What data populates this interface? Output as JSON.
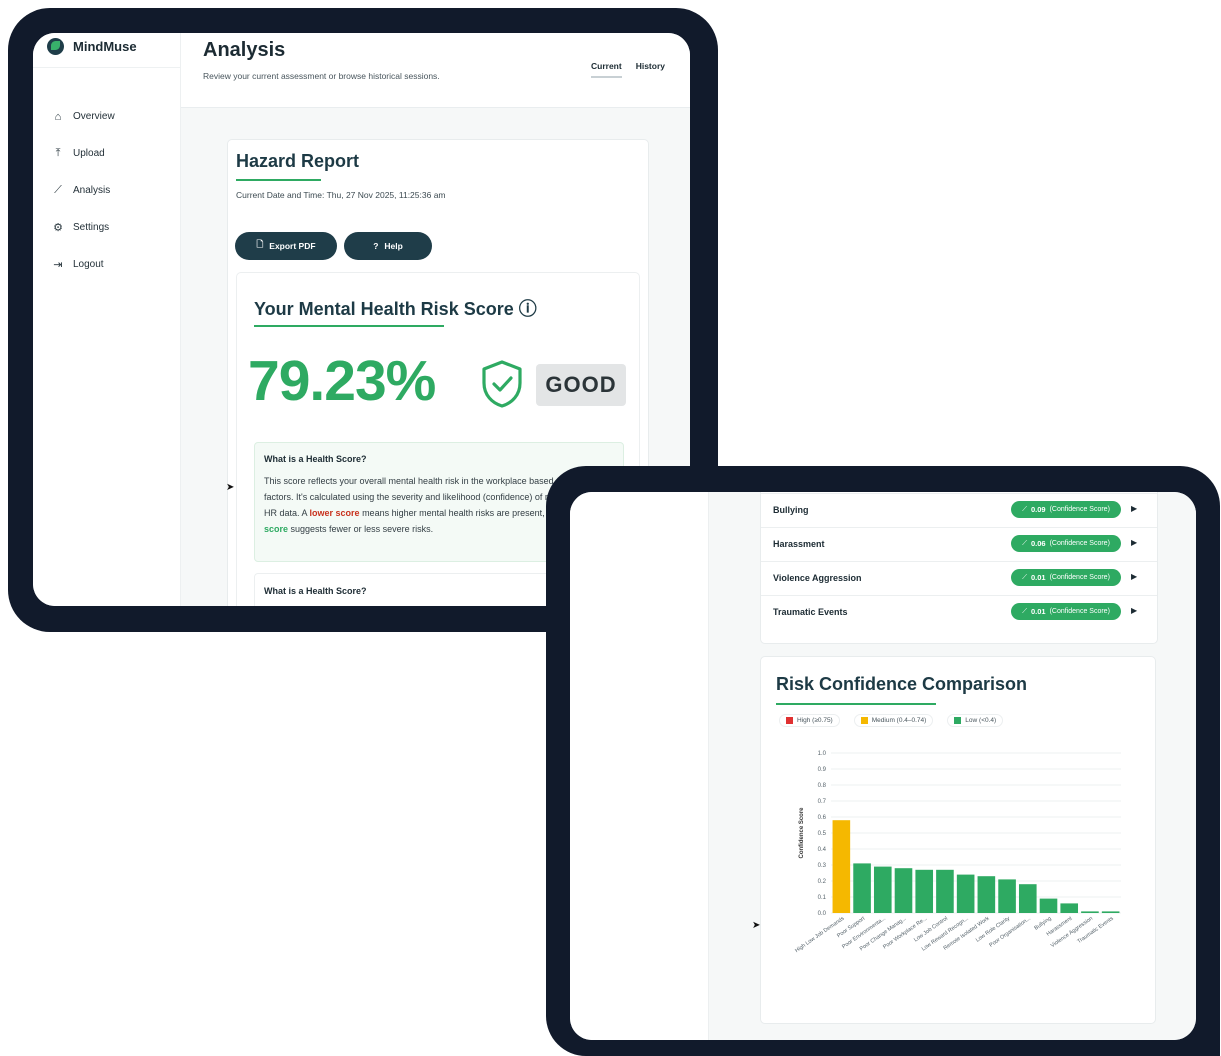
{
  "app": {
    "name": "MindMuse"
  },
  "sidebar": {
    "items": [
      {
        "label": "Overview",
        "icon": "home-icon"
      },
      {
        "label": "Upload",
        "icon": "upload-icon"
      },
      {
        "label": "Analysis",
        "icon": "chart-line-icon"
      },
      {
        "label": "Settings",
        "icon": "gear-icon"
      },
      {
        "label": "Logout",
        "icon": "logout-icon"
      }
    ]
  },
  "header": {
    "title": "Analysis",
    "subtitle": "Review your current assessment or browse historical sessions.",
    "tabs": [
      {
        "label": "Current"
      },
      {
        "label": "History"
      }
    ]
  },
  "report": {
    "title": "Hazard Report",
    "date_label": "Current Date and Time:",
    "date_value": "Thu, 27 Nov 2025, 11:25:36 am",
    "export_label": "Export PDF",
    "help_label": "Help"
  },
  "score": {
    "title": "Your Mental Health Risk Score",
    "info_symbol": "ⓘ",
    "value": "79.23%",
    "status": "GOOD",
    "info_heading": "What is a Health Score?",
    "info_text_1": "This score reflects your overall mental health risk in the workplace based on multiple factors. It's calculated using the severity and likelihood (confidence) of risks from your HR data. A ",
    "info_lower": "lower score",
    "info_text_2": " means higher mental health risks are present, while a ",
    "info_higher": "higher score",
    "info_text_3": " suggests fewer or less severe risks.",
    "info_heading_2": "What is a Health Score?"
  },
  "risks": {
    "confidence_suffix": "(Confidence Score)",
    "rows": [
      {
        "name": "Bullying",
        "score": "0.09"
      },
      {
        "name": "Harassment",
        "score": "0.06"
      },
      {
        "name": "Violence Aggression",
        "score": "0.01"
      },
      {
        "name": "Traumatic Events",
        "score": "0.01"
      }
    ]
  },
  "colors": {
    "accent": "#2eaa62",
    "dark": "#1f3d49",
    "high": "#e03131",
    "medium": "#f5b800",
    "low": "#2eaa62",
    "frame": "#111a2b"
  },
  "chart_data": {
    "type": "bar",
    "title": "Risk Confidence Comparison",
    "ylabel": "Confidence Score",
    "xlabel": "",
    "ylim": [
      0,
      1.0
    ],
    "yticks": [
      "1.0",
      "0.9",
      "0.8",
      "0.7",
      "0.6",
      "0.5",
      "0.4",
      "0.3",
      "0.2",
      "0.1",
      "0.0"
    ],
    "legend": [
      {
        "label": "High (≥0.75)",
        "color": "#e03131"
      },
      {
        "label": "Medium (0.4–0.74)",
        "color": "#f5b800"
      },
      {
        "label": "Low (<0.4)",
        "color": "#2eaa62"
      }
    ],
    "categories": [
      "High Low Job Demands",
      "Poor Support",
      "Poor Environmenta...",
      "Poor Change Manag...",
      "Poor Workplace Re...",
      "Low Job Control",
      "Low Reward Recogn...",
      "Remote Isolated Work",
      "Low Role Clarity",
      "Poor Organisation...",
      "Bullying",
      "Harassment",
      "Violence Aggression",
      "Traumatic Events"
    ],
    "values": [
      0.58,
      0.31,
      0.29,
      0.28,
      0.27,
      0.27,
      0.24,
      0.23,
      0.21,
      0.18,
      0.09,
      0.06,
      0.01,
      0.01
    ],
    "bar_levels": [
      "medium",
      "low",
      "low",
      "low",
      "low",
      "low",
      "low",
      "low",
      "low",
      "low",
      "low",
      "low",
      "low",
      "low"
    ]
  }
}
